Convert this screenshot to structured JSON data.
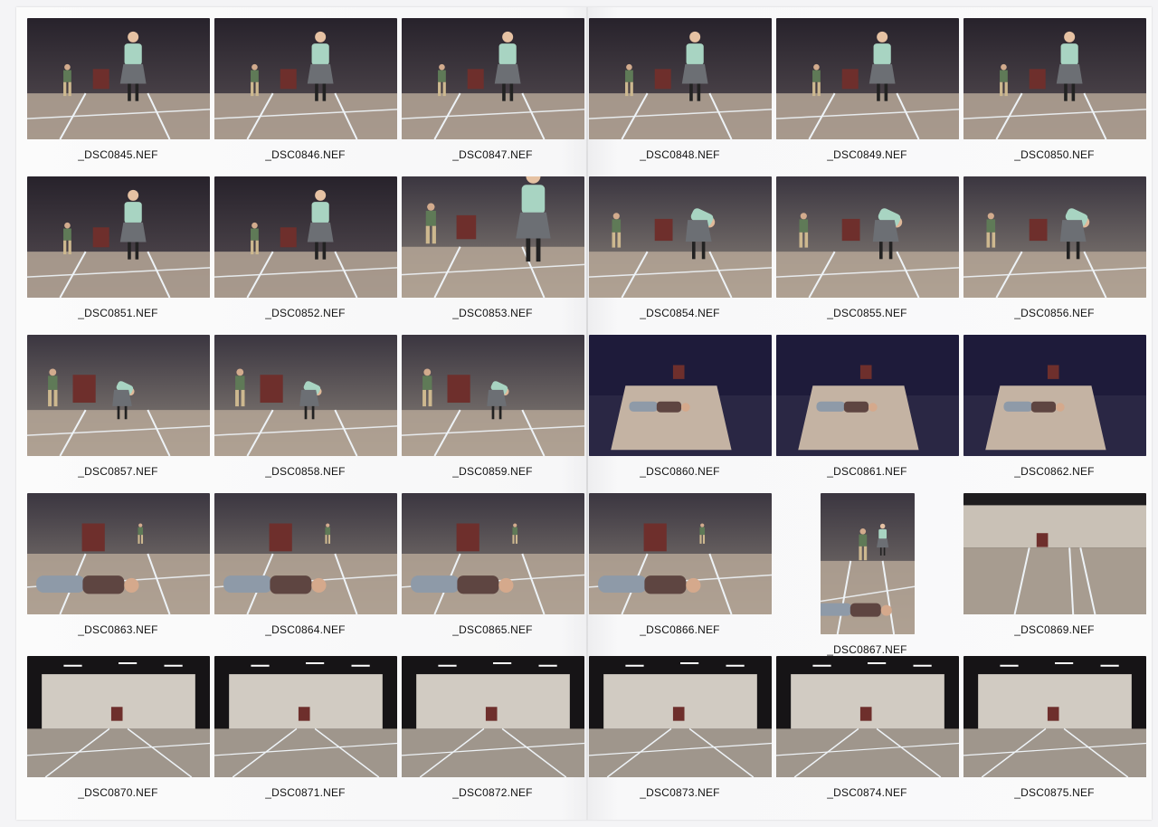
{
  "contact_sheet": {
    "frames": [
      {
        "label": "_DSC0845.NEF",
        "scene": "dancer-standing"
      },
      {
        "label": "_DSC0846.NEF",
        "scene": "dancer-standing"
      },
      {
        "label": "_DSC0847.NEF",
        "scene": "dancer-standing"
      },
      {
        "label": "_DSC0848.NEF",
        "scene": "dancer-standing"
      },
      {
        "label": "_DSC0849.NEF",
        "scene": "dancer-standing"
      },
      {
        "label": "_DSC0850.NEF",
        "scene": "dancer-standing"
      },
      {
        "label": "_DSC0851.NEF",
        "scene": "dancer-standing"
      },
      {
        "label": "_DSC0852.NEF",
        "scene": "dancer-standing"
      },
      {
        "label": "_DSC0853.NEF",
        "scene": "dancer-closeup"
      },
      {
        "label": "_DSC0854.NEF",
        "scene": "dancer-bending"
      },
      {
        "label": "_DSC0855.NEF",
        "scene": "dancer-bending"
      },
      {
        "label": "_DSC0856.NEF",
        "scene": "dancer-bending"
      },
      {
        "label": "_DSC0857.NEF",
        "scene": "dancers-wall"
      },
      {
        "label": "_DSC0858.NEF",
        "scene": "dancers-wall"
      },
      {
        "label": "_DSC0859.NEF",
        "scene": "dancers-wall"
      },
      {
        "label": "_DSC0860.NEF",
        "scene": "person-lying-lit"
      },
      {
        "label": "_DSC0861.NEF",
        "scene": "person-lying-lit"
      },
      {
        "label": "_DSC0862.NEF",
        "scene": "person-lying-lit"
      },
      {
        "label": "_DSC0863.NEF",
        "scene": "person-lying-close"
      },
      {
        "label": "_DSC0864.NEF",
        "scene": "person-lying-close"
      },
      {
        "label": "_DSC0865.NEF",
        "scene": "person-lying-close"
      },
      {
        "label": "_DSC0866.NEF",
        "scene": "person-lying-close"
      },
      {
        "label": "_DSC0867.NEF",
        "scene": "portrait-lying"
      },
      {
        "label": "_DSC0869.NEF",
        "scene": "empty-hall"
      },
      {
        "label": "_DSC0870.NEF",
        "scene": "hall-wide"
      },
      {
        "label": "_DSC0871.NEF",
        "scene": "hall-wide"
      },
      {
        "label": "_DSC0872.NEF",
        "scene": "hall-wide"
      },
      {
        "label": "_DSC0873.NEF",
        "scene": "hall-wide"
      },
      {
        "label": "_DSC0874.NEF",
        "scene": "hall-wide"
      },
      {
        "label": "_DSC0875.NEF",
        "scene": "hall-wide"
      }
    ]
  },
  "colors": {
    "paper": "#f7f7f8",
    "hall_dark": "#2a2530",
    "floor": "#b9aa9a",
    "door": "#6e2f2c",
    "shirt": "#a8d4c2",
    "skirt": "#6c6f74",
    "tape": "#eef3f7"
  }
}
